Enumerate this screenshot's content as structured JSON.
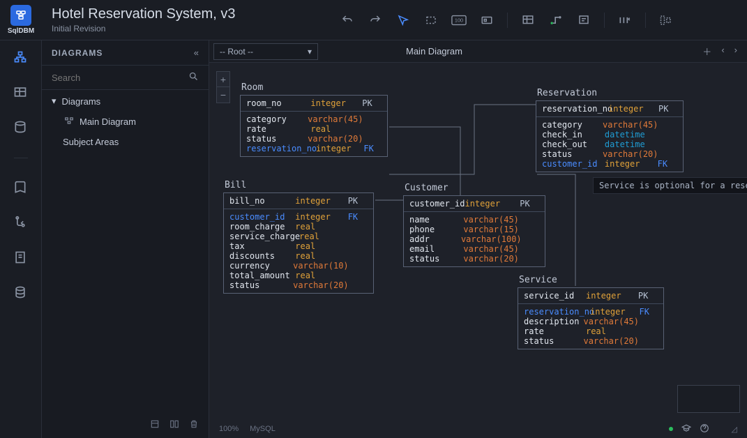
{
  "app": {
    "brand": "SqlDBM",
    "title": "Hotel Reservation System, v3",
    "subtitle": "Initial Revision"
  },
  "sidebar": {
    "header": "DIAGRAMS",
    "search_placeholder": "Search",
    "tree": {
      "root_label": "Diagrams",
      "item_label": "Main Diagram",
      "subject_areas_label": "Subject Areas"
    }
  },
  "tabs": {
    "root_dropdown": "-- Root --",
    "main_tab": "Main Diagram"
  },
  "status": {
    "zoom": "100%",
    "dialect": "MySQL"
  },
  "tooltip": "Service is optional for a reservati",
  "tables": {
    "room": {
      "name": "Room",
      "pk": [
        {
          "col": "room_no",
          "type": "integer",
          "key": "PK"
        }
      ],
      "cols": [
        {
          "col": "category",
          "type": "varchar(45)"
        },
        {
          "col": "rate",
          "type": "real"
        },
        {
          "col": "status",
          "type": "varchar(20)"
        },
        {
          "col": "reservation_no",
          "type": "integer",
          "fk": true,
          "key": "FK"
        }
      ]
    },
    "reservation": {
      "name": "Reservation",
      "pk": [
        {
          "col": "reservation_no",
          "type": "integer",
          "key": "PK"
        }
      ],
      "cols": [
        {
          "col": "category",
          "type": "varchar(45)"
        },
        {
          "col": "check_in",
          "type": "datetime"
        },
        {
          "col": "check_out",
          "type": "datetime"
        },
        {
          "col": "status",
          "type": "varchar(20)"
        },
        {
          "col": "customer_id",
          "type": "integer",
          "fk": true,
          "key": "FK"
        }
      ]
    },
    "bill": {
      "name": "Bill",
      "pk": [
        {
          "col": "bill_no",
          "type": "integer",
          "key": "PK"
        }
      ],
      "cols": [
        {
          "col": "customer_id",
          "type": "integer",
          "fk": true,
          "key": "FK"
        },
        {
          "col": "room_charge",
          "type": "real"
        },
        {
          "col": "service_charge",
          "type": "real"
        },
        {
          "col": "tax",
          "type": "real"
        },
        {
          "col": "discounts",
          "type": "real"
        },
        {
          "col": "currency",
          "type": "varchar(10)"
        },
        {
          "col": "total_amount",
          "type": "real"
        },
        {
          "col": "status",
          "type": "varchar(20)"
        }
      ]
    },
    "customer": {
      "name": "Customer",
      "pk": [
        {
          "col": "customer_id",
          "type": "integer",
          "key": "PK"
        }
      ],
      "cols": [
        {
          "col": "name",
          "type": "varchar(45)"
        },
        {
          "col": "phone",
          "type": "varchar(15)"
        },
        {
          "col": "addr",
          "type": "varchar(100)"
        },
        {
          "col": "email",
          "type": "varchar(45)"
        },
        {
          "col": "status",
          "type": "varchar(20)"
        }
      ]
    },
    "service": {
      "name": "Service",
      "pk": [
        {
          "col": "service_id",
          "type": "integer",
          "key": "PK"
        }
      ],
      "cols": [
        {
          "col": "reservation_no",
          "type": "integer",
          "fk": true,
          "key": "FK"
        },
        {
          "col": "description",
          "type": "varchar(45)"
        },
        {
          "col": "rate",
          "type": "real"
        },
        {
          "col": "status",
          "type": "varchar(20)"
        }
      ]
    }
  }
}
